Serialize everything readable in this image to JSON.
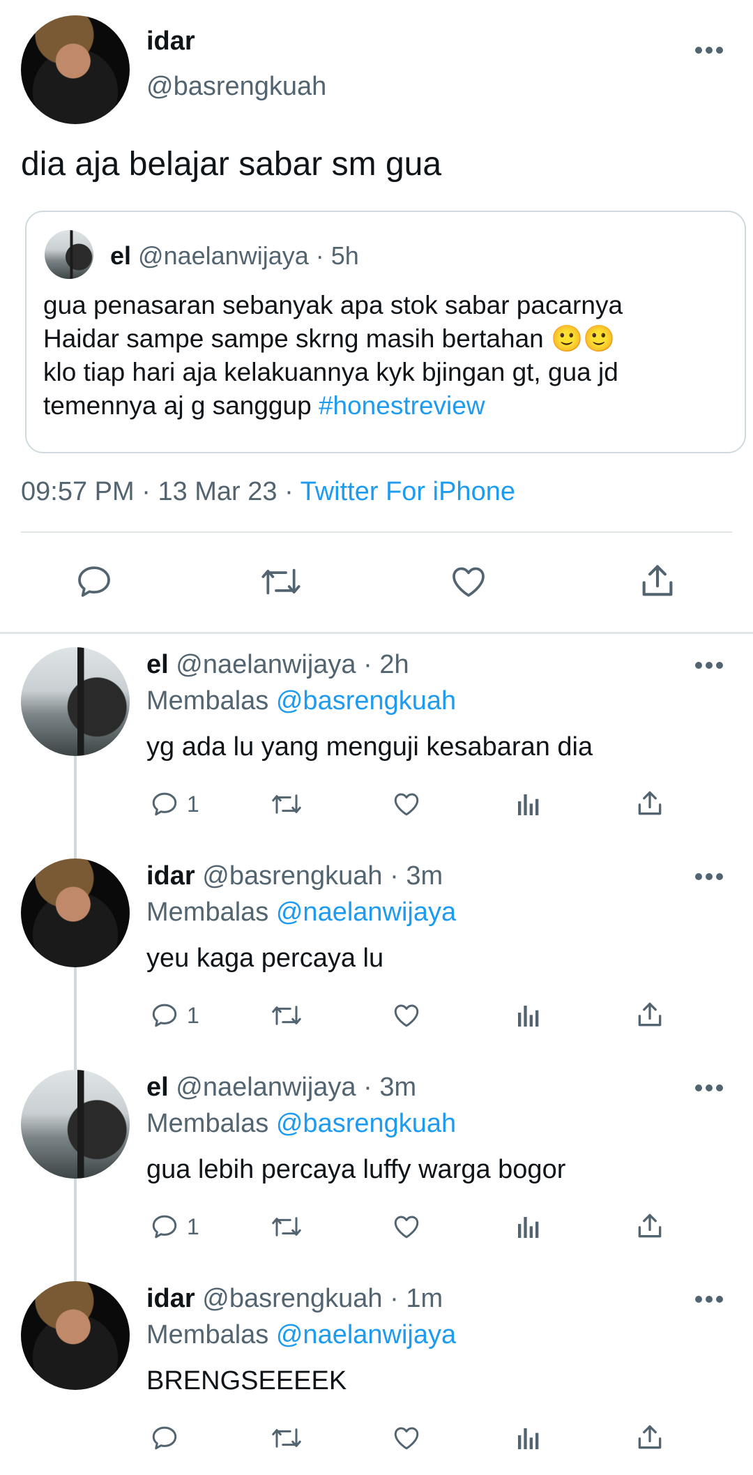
{
  "main_tweet": {
    "display_name": "idar",
    "handle": "@basrengkuah",
    "text": "dia aja belajar sabar sm gua",
    "time": "09:57 PM",
    "date": "13 Mar 23",
    "source": "Twitter For iPhone",
    "separator": " · "
  },
  "quoted_tweet": {
    "display_name": "el",
    "handle": "@naelanwijaya",
    "age": "5h",
    "separator": " · ",
    "lines": [
      "gua penasaran sebanyak apa stok sabar pacarnya",
      "Haidar sampe sampe skrng masih bertahan 🙂🙂",
      "klo tiap hari aja kelakuannya kyk bjingan gt, gua jd"
    ],
    "last_line_text": "temennya aj g sanggup ",
    "hashtag": "#honestreview"
  },
  "replies": [
    {
      "display_name": "el",
      "handle": "@naelanwijaya",
      "age": "2h",
      "replying_prefix": "Membalas",
      "replying_to": "@basrengkuah",
      "text": "yg ada lu yang menguji kesabaran dia",
      "reply_count": "1",
      "avatar": "el"
    },
    {
      "display_name": "idar",
      "handle": "@basrengkuah",
      "age": "3m",
      "replying_prefix": "Membalas",
      "replying_to": "@naelanwijaya",
      "text": "yeu kaga percaya lu",
      "reply_count": "1",
      "avatar": "idar"
    },
    {
      "display_name": "el",
      "handle": "@naelanwijaya",
      "age": "3m",
      "replying_prefix": "Membalas",
      "replying_to": "@basrengkuah",
      "text": "gua lebih percaya luffy warga bogor",
      "reply_count": "1",
      "avatar": "el"
    },
    {
      "display_name": "idar",
      "handle": "@basrengkuah",
      "age": "1m",
      "replying_prefix": "Membalas",
      "replying_to": "@naelanwijaya",
      "text": "BRENGSEEEEK",
      "reply_count": "",
      "avatar": "idar"
    }
  ],
  "icons": {
    "more": "more-icon",
    "reply": "reply-icon",
    "retweet": "retweet-icon",
    "like": "like-icon",
    "share": "share-icon",
    "views": "views-icon"
  },
  "colors": {
    "text": "#0f1419",
    "secondary": "#536471",
    "accent": "#1d9bf0",
    "divider": "#e1e6e9"
  }
}
